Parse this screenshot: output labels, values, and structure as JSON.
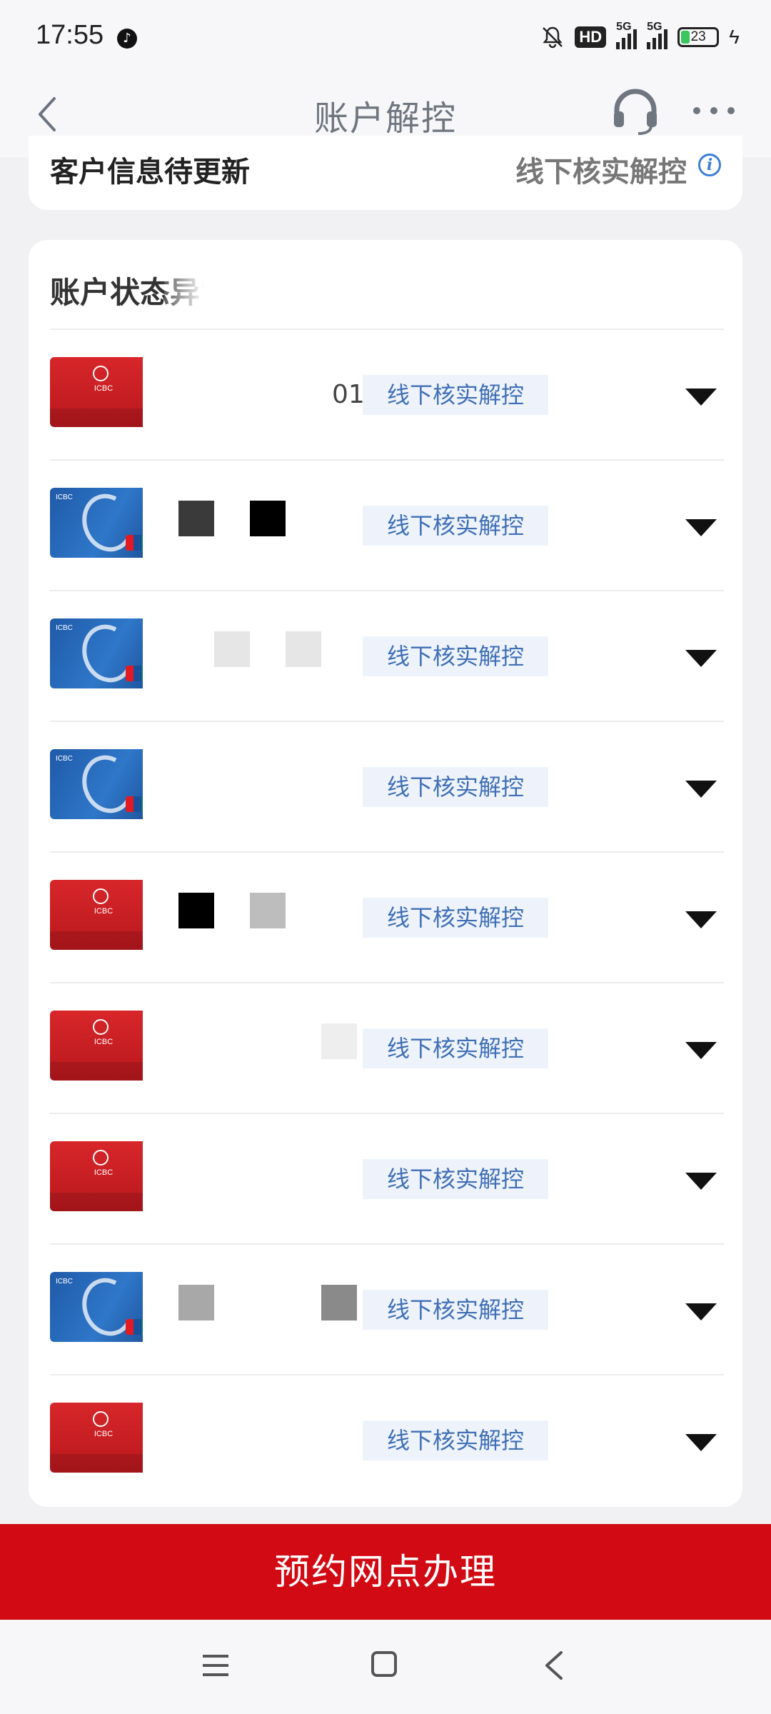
{
  "status_bar": {
    "time": "17:55",
    "hd_label": "HD",
    "network_1": "5G",
    "network_2": "5G",
    "battery": "23",
    "icons": [
      "tiktok-icon",
      "mute-bell-icon",
      "signal-icon",
      "battery-icon",
      "charging-icon"
    ]
  },
  "header": {
    "title": "账户解控",
    "icons": [
      "back-icon",
      "customer-service-icon",
      "more-icon"
    ]
  },
  "customer_info": {
    "label": "客户信息待更新",
    "action": "线下核实解控",
    "info_icon": "i"
  },
  "accounts_section": {
    "title": "账户状态异常",
    "rows": [
      {
        "card": "red",
        "account_visible": "01",
        "status": "线下核实解控"
      },
      {
        "card": "blue",
        "account_visible": "",
        "status": "线下核实解控"
      },
      {
        "card": "blue",
        "account_visible": "",
        "status": "线下核实解控"
      },
      {
        "card": "blue",
        "account_visible": "",
        "status": "线下核实解控"
      },
      {
        "card": "red",
        "account_visible": "",
        "status": "线下核实解控"
      },
      {
        "card": "red",
        "account_visible": "",
        "status": "线下核实解控"
      },
      {
        "card": "red",
        "account_visible": "",
        "status": "线下核实解控"
      },
      {
        "card": "blue",
        "account_visible": "",
        "status": "线下核实解控"
      },
      {
        "card": "red",
        "account_visible": "",
        "status": "线下核实解控"
      }
    ]
  },
  "bottom_button": {
    "label": "预约网点办理"
  },
  "colors": {
    "brand_red": "#d20a13",
    "badge_bg": "#eef3fb",
    "badge_text": "#3f6fb6",
    "info_blue": "#3d7fd6"
  }
}
